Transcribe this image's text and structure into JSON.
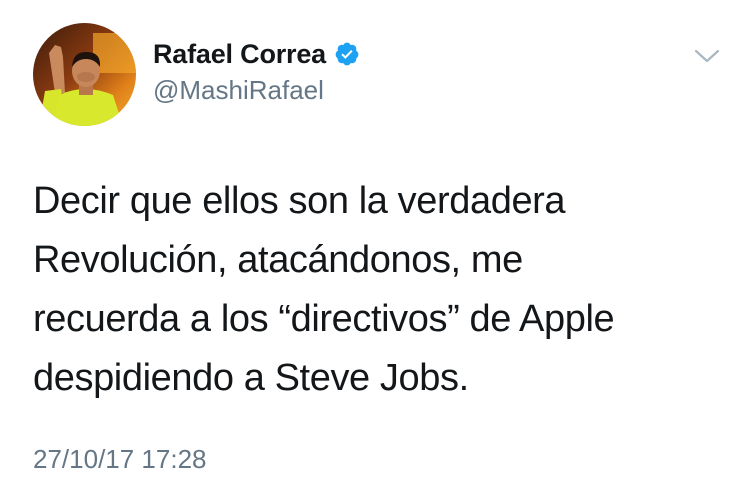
{
  "author": {
    "display_name": "Rafael Correa",
    "handle": "@MashiRafael",
    "verified": true,
    "avatar_icon": "profile-photo"
  },
  "tweet": {
    "text_lines": [
      "Decir que ellos son la verdadera",
      "Revolución, atacándonos, me",
      "recuerda a los “directivos” de Apple",
      "despidiendo a Steve Jobs."
    ],
    "timestamp": "27/10/17 17:28"
  },
  "icons": {
    "verified": "verified-badge-icon",
    "menu": "chevron-down-icon"
  },
  "colors": {
    "primary_text": "#14171a",
    "secondary_text": "#657786",
    "verified_blue": "#1da1f2",
    "caret_gray": "#aab8c2"
  }
}
